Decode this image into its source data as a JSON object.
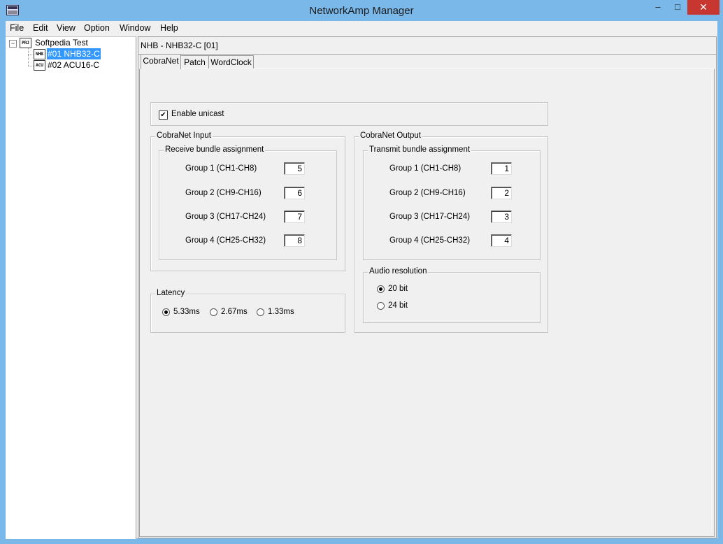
{
  "window": {
    "title": "NetworkAmp Manager",
    "minimize": "–",
    "maximize": "□",
    "close": "✕"
  },
  "menu": [
    "File",
    "Edit",
    "View",
    "Option",
    "Window",
    "Help"
  ],
  "tree": {
    "root": {
      "icon": "PRJ",
      "label": "Softpedia Test",
      "expander": "−"
    },
    "children": [
      {
        "icon": "NHB",
        "label": "#01 NHB32-C",
        "selected": true
      },
      {
        "icon": "ACU",
        "label": "#02 ACU16-C",
        "selected": false
      }
    ]
  },
  "device_header": "NHB - NHB32-C [01]",
  "tabs": [
    "CobraNet",
    "Patch",
    "WordClock"
  ],
  "unicast": {
    "label": "Enable unicast",
    "checked": true,
    "mark": "✔"
  },
  "cobranet_input": {
    "title": "CobraNet Input",
    "subtitle": "Receive bundle assignment",
    "groups": [
      {
        "label": "Group 1 (CH1-CH8)",
        "value": "5"
      },
      {
        "label": "Group 2 (CH9-CH16)",
        "value": "6"
      },
      {
        "label": "Group 3 (CH17-CH24)",
        "value": "7"
      },
      {
        "label": "Group 4 (CH25-CH32)",
        "value": "8"
      }
    ]
  },
  "cobranet_output": {
    "title": "CobraNet Output",
    "subtitle": "Transmit bundle assignment",
    "groups": [
      {
        "label": "Group 1 (CH1-CH8)",
        "value": "1"
      },
      {
        "label": "Group 2 (CH9-CH16)",
        "value": "2"
      },
      {
        "label": "Group 3 (CH17-CH24)",
        "value": "3"
      },
      {
        "label": "Group 4 (CH25-CH32)",
        "value": "4"
      }
    ]
  },
  "latency": {
    "title": "Latency",
    "options": [
      {
        "label": "5.33ms",
        "checked": true
      },
      {
        "label": "2.67ms",
        "checked": false
      },
      {
        "label": "1.33ms",
        "checked": false
      }
    ]
  },
  "audio_resolution": {
    "title": "Audio resolution",
    "options": [
      {
        "label": "20 bit",
        "checked": true
      },
      {
        "label": "24 bit",
        "checked": false
      }
    ]
  }
}
